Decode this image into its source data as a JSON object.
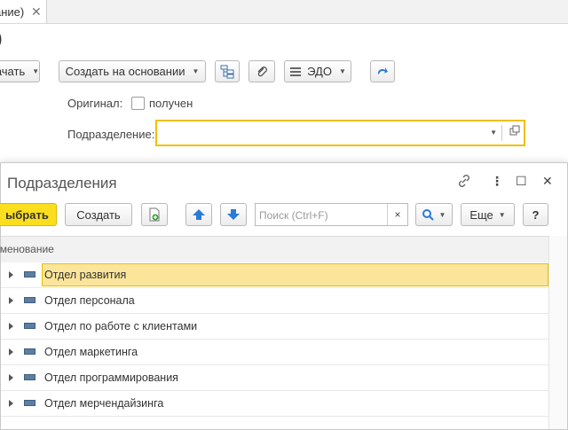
{
  "tab": {
    "label": "ание)",
    "close": "✕"
  },
  "document": {
    "title_fragment": ")"
  },
  "toolbar": {
    "print_label": "ачать",
    "create_based_label": "Создать на основании",
    "edo_label": "ЭДО"
  },
  "form": {
    "original_label": "Оригинал:",
    "received_label": "получен",
    "department_label": "Подразделение:",
    "department_value": ""
  },
  "dialog": {
    "title": "Подразделения",
    "controls": {
      "link": "🔗",
      "more": "⋮",
      "maximize": "☐",
      "close": "✕"
    },
    "toolbar": {
      "select_label": "ыбрать",
      "create_label": "Создать",
      "search_placeholder": "Поиск (Ctrl+F)",
      "search_clear": "×",
      "more_label": "Еще",
      "help_label": "?"
    },
    "column_header": "именование",
    "rows": [
      "Отдел развития",
      "Отдел персонала",
      "Отдел по работе с клиентами",
      "Отдел маркетинга",
      "Отдел программирования",
      "Отдел мерчендайзинга"
    ],
    "selected_row": 0
  },
  "colors": {
    "accent_yellow": "#fbde1e",
    "focus_border": "#f0c000",
    "selected_row": "#fbe59a",
    "arrow_blue": "#2a7bd6"
  }
}
